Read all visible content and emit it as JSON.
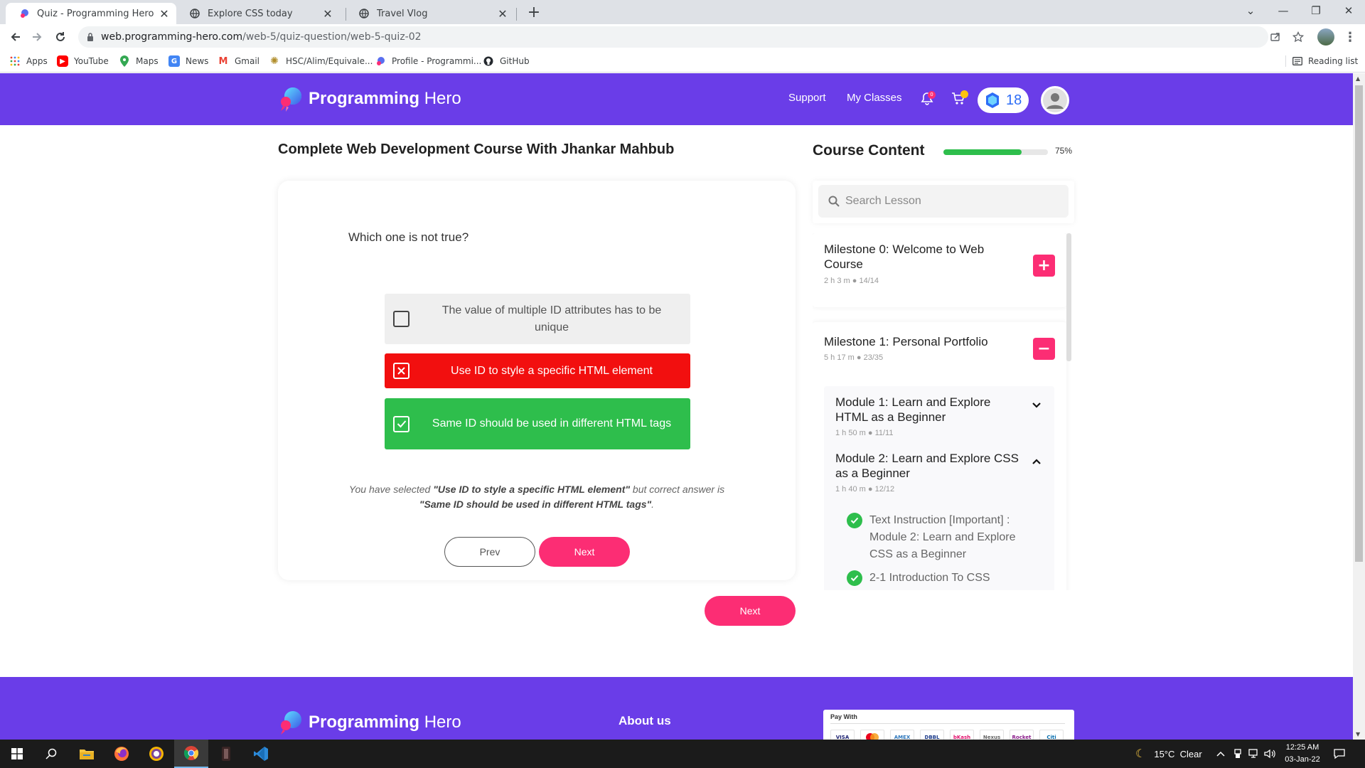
{
  "browser": {
    "tabs": [
      {
        "title": "Quiz - Programming Hero",
        "active": true
      },
      {
        "title": "Explore CSS today",
        "active": false
      },
      {
        "title": "Travel Vlog",
        "active": false
      }
    ],
    "url_domain": "web.programming-hero.com",
    "url_path": "/web-5/quiz-question/web-5-quiz-02",
    "bookmarks": [
      "Apps",
      "YouTube",
      "Maps",
      "News",
      "Gmail",
      "HSC/Alim/Equivale...",
      "Profile - Programmi...",
      "GitHub"
    ],
    "reading_list": "Reading list"
  },
  "header": {
    "logo_text_bold": "Programming",
    "logo_text_light": " Hero",
    "nav": {
      "support": "Support",
      "my_classes": "My Classes"
    },
    "notification_count": "0",
    "gems": "18"
  },
  "course": {
    "title": "Complete Web Development Course With Jhankar Mahbub"
  },
  "quiz": {
    "question": "Which one is not true?",
    "options": [
      {
        "text": "The value of multiple ID attributes has to be unique",
        "state": "neutral"
      },
      {
        "text": "Use ID to style a specific HTML element",
        "state": "wrong"
      },
      {
        "text": "Same ID should be used in different HTML tags",
        "state": "correct"
      }
    ],
    "feedback": {
      "p1": "You have selected ",
      "selected": "\"Use ID to style a specific HTML element\"",
      "p2": " but correct answer is ",
      "correct": "\"Same ID should be used in different HTML tags\"",
      "p3": "."
    },
    "prev_label": "Prev",
    "next_label": "Next"
  },
  "main_next_label": "Next",
  "sidebar": {
    "title": "Course Content",
    "progress_percent": 75,
    "progress_label": "75%",
    "search_placeholder": "Search Lesson",
    "milestones": [
      {
        "title": "Milestone 0: Welcome to Web Course",
        "duration": "2 h 3 m",
        "count": "14/14",
        "toggle": "+"
      },
      {
        "title": "Milestone 1: Personal Portfolio",
        "duration": "5 h 17 m",
        "count": "23/35",
        "toggle": "−"
      }
    ],
    "modules": [
      {
        "title": "Module 1: Learn and Explore HTML as a Beginner",
        "duration": "1 h 50 m",
        "count": "11/11"
      },
      {
        "title": "Module 2: Learn and Explore CSS as a Beginner",
        "duration": "1 h 40 m",
        "count": "12/12"
      }
    ],
    "lessons": [
      "Text Instruction [Important] : Module 2: Learn and Explore CSS as a Beginner",
      "2-1 Introduction To CSS"
    ]
  },
  "footer": {
    "about": "About us",
    "pay_with": "Pay With",
    "cards": [
      "VISA",
      "MC",
      "AMEX",
      "DBBL",
      "bKash",
      "Nexus",
      "Rocket",
      "Citi"
    ]
  },
  "taskbar": {
    "weather": "15°C  Clear",
    "time": "12:25 AM",
    "date": "03-Jan-22"
  },
  "colors": {
    "brand_purple": "#6a3de8",
    "accent_pink": "#fc2d74",
    "wrong_red": "#f20f0f",
    "correct_green": "#2ebe4c"
  }
}
